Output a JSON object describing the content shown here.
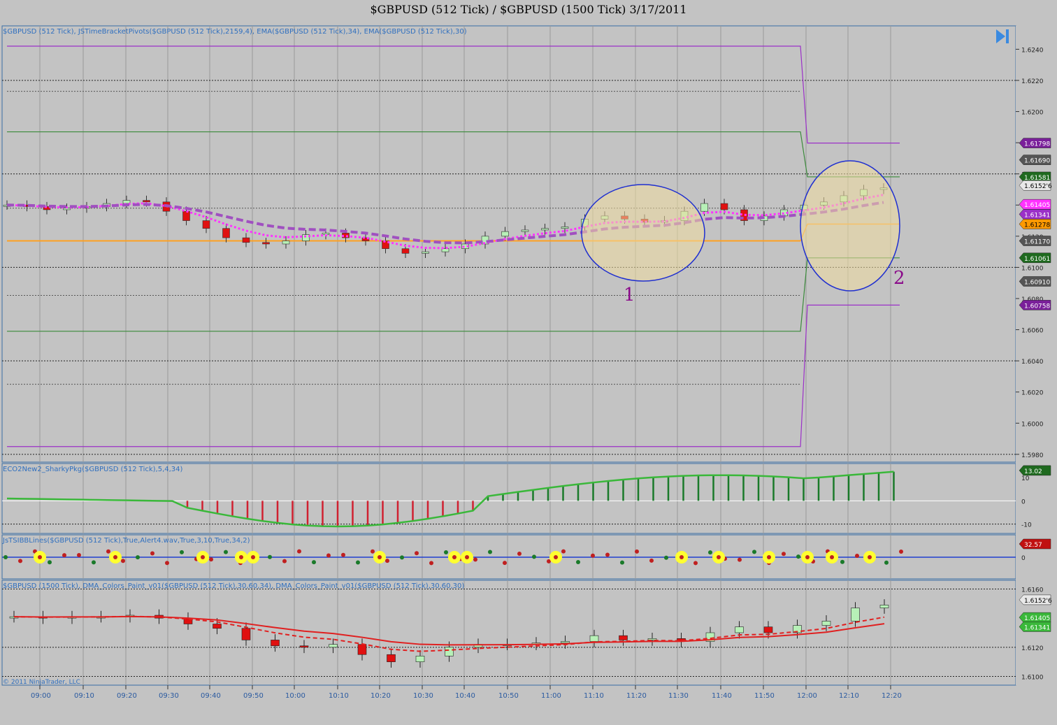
{
  "title": "$GBPUSD (512 Tick) / $GBPUSD (1500 Tick)  3/17/2011",
  "colors": {
    "background": "#c3c3c3",
    "border": "#3a6ea5",
    "label_text": "#2f6fbf",
    "candle_up": "#b7f0b7",
    "candle_down": "#e01010",
    "candle_neutral": "#a8a8a8",
    "candle_dark_up": "#1a7a2a",
    "pivot_purple": "#9b30c8",
    "pivot_green": "#3a8a3a",
    "ema_magenta": "#ff33ff",
    "ema_purple": "#a050c0",
    "orange": "#ffa020",
    "annotation": "#8a0a8a"
  },
  "icons": {
    "skip_end": "skip-to-end-icon"
  },
  "copyright": "© 2011 NinjaTrader, LLC",
  "chart_data": [
    {
      "panel": "price",
      "type": "candlestick",
      "label": "$GBPUSD (512 Tick), JSTimeBracketPivots($GBPUSD (512 Tick),2159,4), EMA($GBPUSD (512 Tick),34), EMA($GBPUSD (512 Tick),30)",
      "yticks": [
        "1.6240",
        "1.6220",
        "1.6200",
        "1.6180",
        "1.6160",
        "1.6140",
        "1.6120",
        "1.6100",
        "1.6080",
        "1.6060",
        "1.6040",
        "1.6020",
        "1.6000",
        "1.5980"
      ],
      "ylim": [
        1.5975,
        1.6255
      ],
      "price_flags": [
        {
          "text": "1.61798",
          "value": 1.61798,
          "color": "#7a1f9a"
        },
        {
          "text": "1.61690",
          "value": 1.6169,
          "color": "#555555"
        },
        {
          "text": "1.61581",
          "value": 1.61581,
          "color": "#1f6a1f"
        },
        {
          "text": "1.6152'6",
          "value": 1.61526,
          "color": "#e8e8e8",
          "text_color": "#000"
        },
        {
          "text": "1.61405",
          "value": 1.61405,
          "color": "#ff33ff"
        },
        {
          "text": "1.61341",
          "value": 1.61341,
          "color": "#9b30c8"
        },
        {
          "text": "1.61278",
          "value": 1.61278,
          "color": "#ff9900",
          "text_color": "#000"
        },
        {
          "text": "1.61170",
          "value": 1.6117,
          "color": "#555555"
        },
        {
          "text": "1.61061",
          "value": 1.61061,
          "color": "#1f6a1f"
        },
        {
          "text": "1.60910",
          "value": 1.6091,
          "color": "#555555"
        },
        {
          "text": "1.60758",
          "value": 1.60758,
          "color": "#7a1f9a"
        }
      ],
      "annotations": [
        "1",
        "2"
      ]
    },
    {
      "panel": "oscillator",
      "type": "histogram",
      "label": "ECO2New2_SharkyPkg($GBPUSD (512 Tick),5,4,34)",
      "yticks": [
        "10",
        "0",
        "-10"
      ],
      "ylim": [
        -14,
        16
      ],
      "value_flag": "13.02"
    },
    {
      "panel": "bands",
      "type": "line",
      "label": "JsTSIBBLines($GBPUSD (512 Tick),True,Alert4.wav,True,3,10,True,34,2)",
      "yticks": [
        "0"
      ],
      "value_flag": "32.57"
    },
    {
      "panel": "higher_tf",
      "type": "candlestick",
      "label": "$GBPUSD (1500 Tick), DMA_Colors_Paint_v01($GBPUSD (512 Tick),30,60,34), DMA_Colors_Paint_v01($GBPUSD (512 Tick),30,60,30)",
      "yticks": [
        "1.6160",
        "1.6120",
        "1.6100"
      ],
      "ylim": [
        1.6094,
        1.6166
      ],
      "price_flags": [
        {
          "text": "1.6152'6",
          "value": 1.61526,
          "color": "#e8e8e8",
          "text_color": "#000"
        },
        {
          "text": "1.61405",
          "value": 1.61405,
          "color": "#3ab83a"
        },
        {
          "text": "1.61341",
          "value": 1.61341,
          "color": "#3ab83a"
        }
      ]
    }
  ],
  "x_axis": {
    "ticks": [
      "09:00",
      "09:10",
      "09:20",
      "09:30",
      "09:40",
      "09:50",
      "10:00",
      "10:10",
      "10:20",
      "10:30",
      "10:40",
      "10:50",
      "11:00",
      "11:10",
      "11:20",
      "11:30",
      "11:40",
      "11:50",
      "12:00",
      "12:10",
      "12:20"
    ]
  }
}
